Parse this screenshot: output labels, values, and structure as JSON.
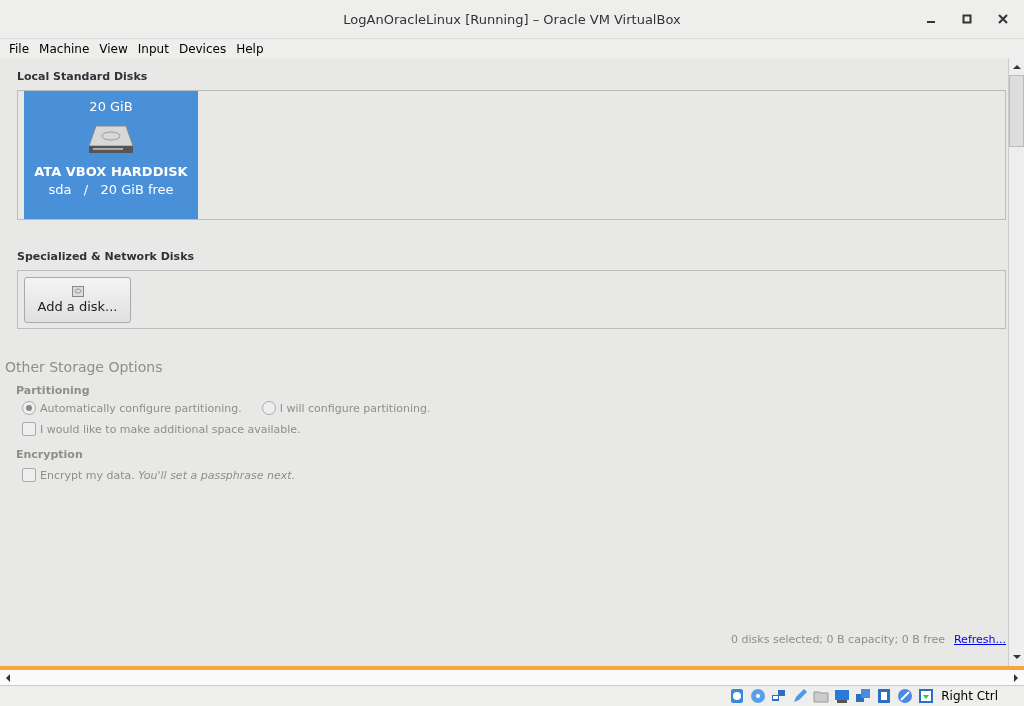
{
  "window": {
    "title": "LogAnOracleLinux [Running] – Oracle VM VirtualBox"
  },
  "menu": [
    "File",
    "Machine",
    "View",
    "Input",
    "Devices",
    "Help"
  ],
  "local_disks": {
    "heading": "Local Standard Disks",
    "disks": [
      {
        "size": "20 GiB",
        "name": "ATA VBOX HARDDISK",
        "device": "sda",
        "separator": "/",
        "free": "20 GiB free",
        "selected": true
      }
    ]
  },
  "network_disks": {
    "heading": "Specialized & Network Disks",
    "button": "Add a disk..."
  },
  "other_options": {
    "heading": "Other Storage Options",
    "disabled": true,
    "partitioning": {
      "heading": "Partitioning",
      "radios": [
        {
          "label": "Automatically configure partitioning.",
          "selected": true
        },
        {
          "label": "I will configure partitioning.",
          "selected": false
        }
      ],
      "checkbox": {
        "label": "I would like to make additional space available.",
        "checked": false
      }
    },
    "encryption": {
      "heading": "Encryption",
      "checkbox": {
        "label": "Encrypt my data. *You'll set a passphrase next.*",
        "checked": false
      }
    }
  },
  "summary": {
    "text": "0 disks selected; 0 B capacity; 0 B free",
    "link": "Refresh..."
  },
  "status_bar": {
    "host_key": "Right Ctrl"
  }
}
